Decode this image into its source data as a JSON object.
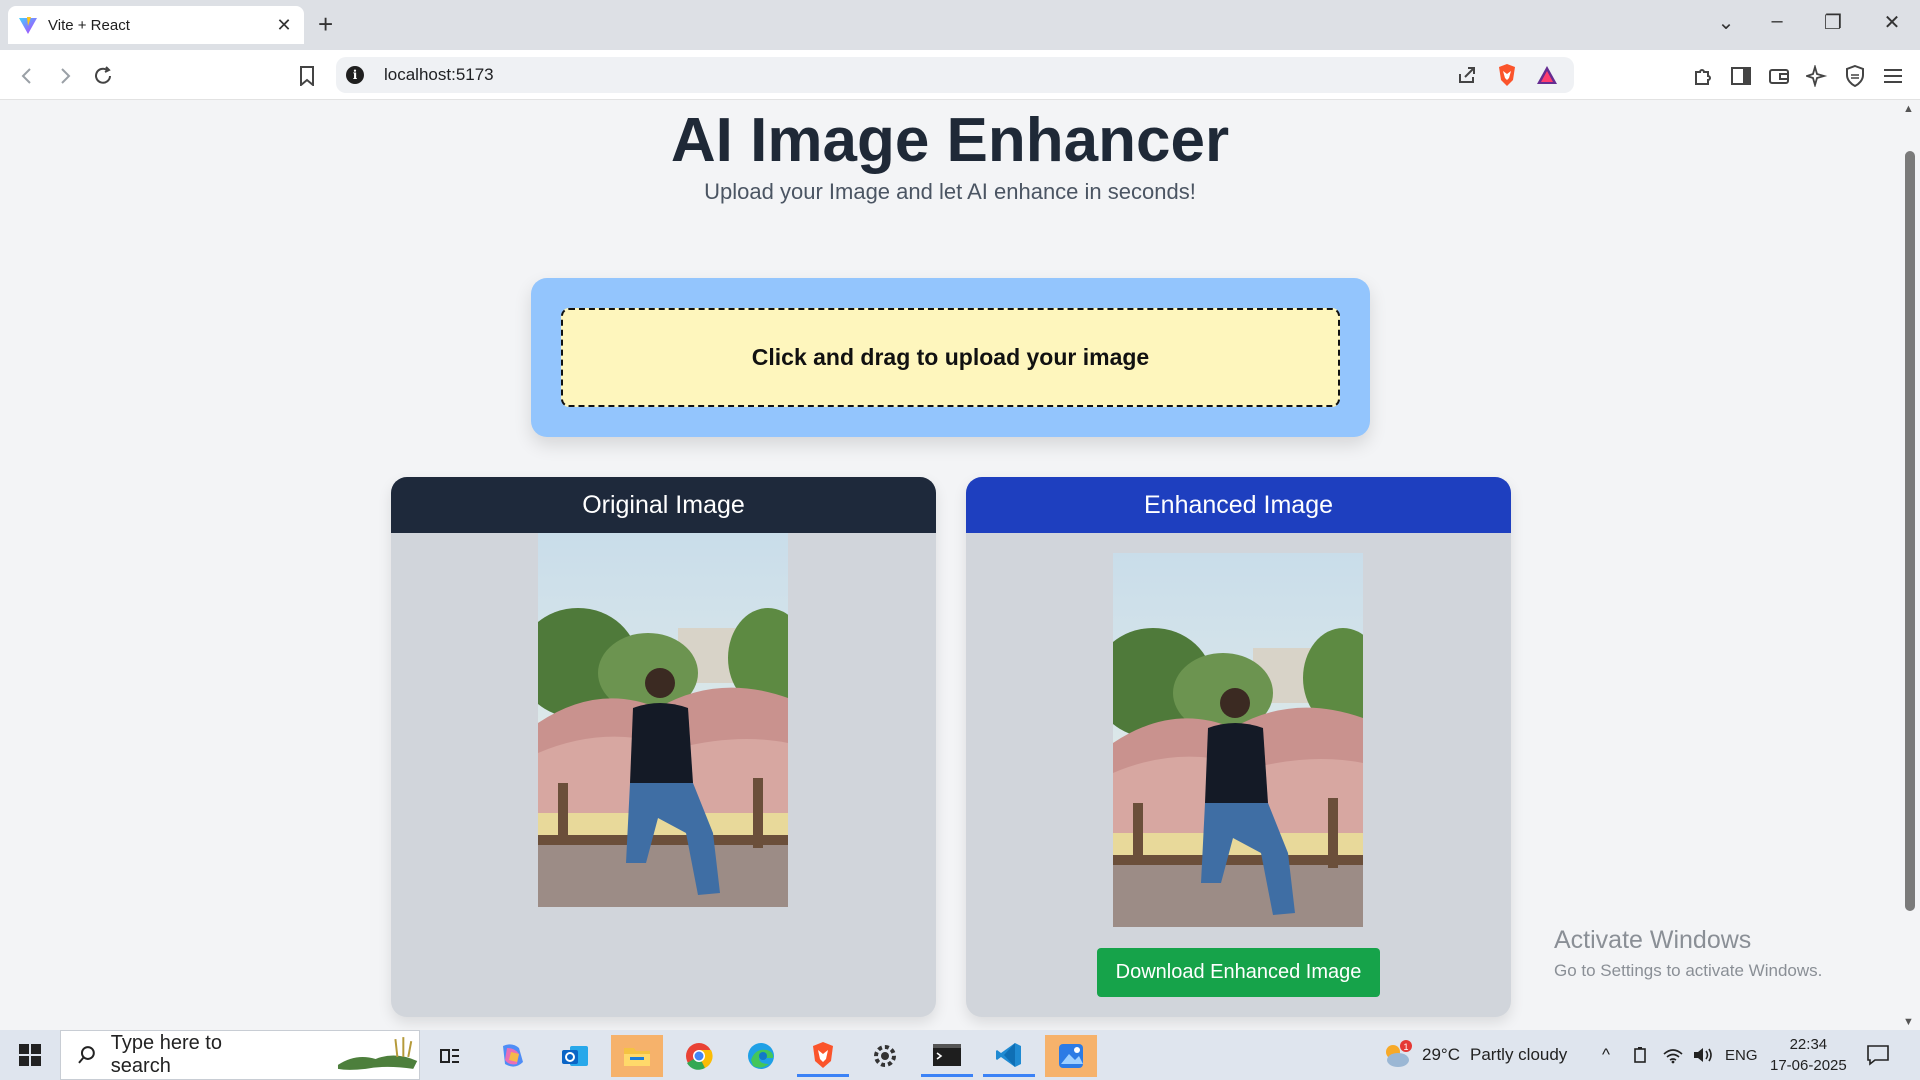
{
  "browser": {
    "tab_title": "Vite + React",
    "new_tab": "+",
    "url": "localhost:5173"
  },
  "page": {
    "title": "AI Image Enhancer",
    "subtitle": "Upload your Image and let AI enhance in seconds!",
    "upload_label": "Click and drag to upload your image",
    "original_header": "Original Image",
    "enhanced_header": "Enhanced Image",
    "download_label": "Download Enhanced Image"
  },
  "watermark": {
    "line1": "Activate Windows",
    "line2": "Go to Settings to activate Windows."
  },
  "taskbar": {
    "search_placeholder": "Type here to search",
    "weather_temp": "29°C",
    "weather_desc": "Partly cloudy",
    "weather_badge": "1",
    "language": "ENG",
    "time": "22:34",
    "date": "17-06-2025"
  },
  "colors": {
    "upload_bg": "#93c5fd",
    "drop_bg": "#fef6bd",
    "original_header": "#1e293b",
    "enhanced_header": "#1e3fbf",
    "download_button": "#16a34a"
  }
}
